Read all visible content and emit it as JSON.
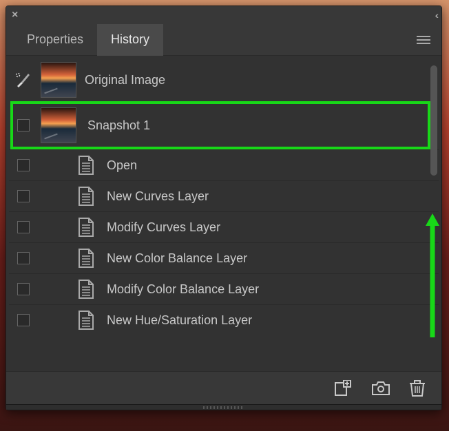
{
  "tabs": {
    "properties": "Properties",
    "history": "History"
  },
  "source": {
    "label": "Original Image"
  },
  "snapshot": {
    "label": "Snapshot 1"
  },
  "history_items": [
    {
      "label": "Open"
    },
    {
      "label": "New Curves Layer"
    },
    {
      "label": "Modify Curves Layer"
    },
    {
      "label": "New Color Balance Layer"
    },
    {
      "label": "Modify Color Balance Layer"
    },
    {
      "label": "New Hue/Saturation Layer"
    }
  ],
  "icons": {
    "close": "×",
    "collapse": "‹‹"
  },
  "colors": {
    "highlight": "#18d818",
    "panel_bg": "#383838",
    "content_bg": "#323232",
    "text": "#c8c8c8"
  }
}
